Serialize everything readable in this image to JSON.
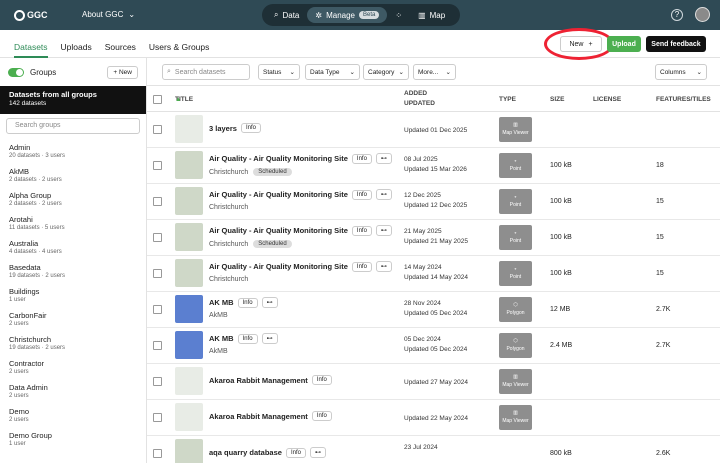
{
  "topbar": {
    "logo": "GGC",
    "about": "About GGC",
    "nav": [
      {
        "label": "Data",
        "icon": "search-icon"
      },
      {
        "label": "Manage",
        "icon": "gear-icon",
        "badge": "Beta"
      },
      {
        "label": "Map",
        "icon": "map-icon"
      }
    ],
    "help": "?"
  },
  "tabs": [
    "Datasets",
    "Uploads",
    "Sources",
    "Users & Groups"
  ],
  "actions": {
    "new": "New",
    "new_icon": "+",
    "upload": "Upload",
    "feedback": "Send feedback"
  },
  "sidebar": {
    "groups_label": "Groups",
    "new_label": "+ New",
    "all_title": "Datasets from all groups",
    "all_count": "142 datasets",
    "search_placeholder": "Search groups",
    "items": [
      {
        "name": "Admin",
        "count": "20 datasets · 3 users"
      },
      {
        "name": "AkMB",
        "count": "2 datasets · 2 users"
      },
      {
        "name": "Alpha Group",
        "count": "2 datasets · 2 users"
      },
      {
        "name": "Arotahi",
        "count": "11 datasets · 5 users"
      },
      {
        "name": "Australia",
        "count": "4 datasets · 4 users"
      },
      {
        "name": "Basedata",
        "count": "19 datasets · 2 users"
      },
      {
        "name": "Buildings",
        "count": "1 user"
      },
      {
        "name": "CarbonFair",
        "count": "2 users"
      },
      {
        "name": "Christchurch",
        "count": "19 datasets · 2 users"
      },
      {
        "name": "Contractor",
        "count": "2 users"
      },
      {
        "name": "Data Admin",
        "count": "2 users"
      },
      {
        "name": "Demo",
        "count": "2 users"
      },
      {
        "name": "Demo Group",
        "count": "1 user"
      }
    ]
  },
  "toolbar": {
    "search_placeholder": "Search datasets",
    "filters": [
      "Status",
      "Data Type",
      "Category",
      "More..."
    ],
    "columns": "Columns"
  },
  "table": {
    "headers": [
      "TITLE",
      "ADDED",
      "UPDATED",
      "TYPE",
      "SIZE",
      "LICENSE",
      "FEATURES/TILES"
    ],
    "rows": [
      {
        "title": "3 layers",
        "chips": [
          "Info"
        ],
        "sub": "",
        "scheduled": "",
        "added": "",
        "updated": "Updated 01 Dec 2025",
        "type": "Map Viewer",
        "size": "",
        "features": "",
        "thumb": "nz"
      },
      {
        "title": "Air Quality - Air Quality Monitoring Site",
        "chips": [
          "Info",
          "⊷"
        ],
        "sub": "Christchurch",
        "scheduled": "Scheduled",
        "added": "08 Jul 2025",
        "updated": "Updated 15 Mar 2026",
        "type": "Point",
        "size": "100 kB",
        "features": "18",
        "thumb": "map"
      },
      {
        "title": "Air Quality - Air Quality Monitoring Site",
        "chips": [
          "Info",
          "⊷"
        ],
        "sub": "Christchurch",
        "scheduled": "",
        "added": "12 Dec 2025",
        "updated": "Updated 12 Dec 2025",
        "type": "Point",
        "size": "100 kB",
        "features": "15",
        "thumb": "map"
      },
      {
        "title": "Air Quality - Air Quality Monitoring Site",
        "chips": [
          "Info",
          "⊷"
        ],
        "sub": "Christchurch",
        "scheduled": "Scheduled",
        "added": "21 May 2025",
        "updated": "Updated 21 May 2025",
        "type": "Point",
        "size": "100 kB",
        "features": "15",
        "thumb": "map"
      },
      {
        "title": "Air Quality - Air Quality Monitoring Site",
        "chips": [
          "Info",
          "⊷"
        ],
        "sub": "Christchurch",
        "scheduled": "",
        "added": "14 May 2024",
        "updated": "Updated 14 May 2024",
        "type": "Point",
        "size": "100 kB",
        "features": "15",
        "thumb": "map"
      },
      {
        "title": "AK MB",
        "chips": [
          "Info",
          "⊷"
        ],
        "sub": "AkMB",
        "scheduled": "",
        "added": "28 Nov 2024",
        "updated": "Updated 05 Dec 2024",
        "type": "Polygon",
        "size": "12 MB",
        "features": "2.7K",
        "thumb": "poly"
      },
      {
        "title": "AK MB",
        "chips": [
          "Info",
          "⊷"
        ],
        "sub": "AkMB",
        "scheduled": "",
        "added": "05 Dec 2024",
        "updated": "Updated 05 Dec 2024",
        "type": "Polygon",
        "size": "2.4 MB",
        "features": "2.7K",
        "thumb": "poly"
      },
      {
        "title": "Akaroa Rabbit Management",
        "chips": [
          "Info"
        ],
        "sub": "",
        "scheduled": "",
        "added": "",
        "updated": "Updated 27 May 2024",
        "type": "Map Viewer",
        "size": "",
        "features": "",
        "thumb": "nz"
      },
      {
        "title": "Akaroa Rabbit Management",
        "chips": [
          "Info"
        ],
        "sub": "",
        "scheduled": "",
        "added": "",
        "updated": "Updated 22 May 2024",
        "type": "Map Viewer",
        "size": "",
        "features": "",
        "thumb": "nz"
      },
      {
        "title": "aqa quarry database",
        "chips": [
          "Info",
          "⊷"
        ],
        "sub": "",
        "scheduled": "",
        "added": "23 Jul 2024",
        "updated": "",
        "type": "",
        "size": "800 kB",
        "features": "2.6K",
        "thumb": "map"
      }
    ]
  }
}
